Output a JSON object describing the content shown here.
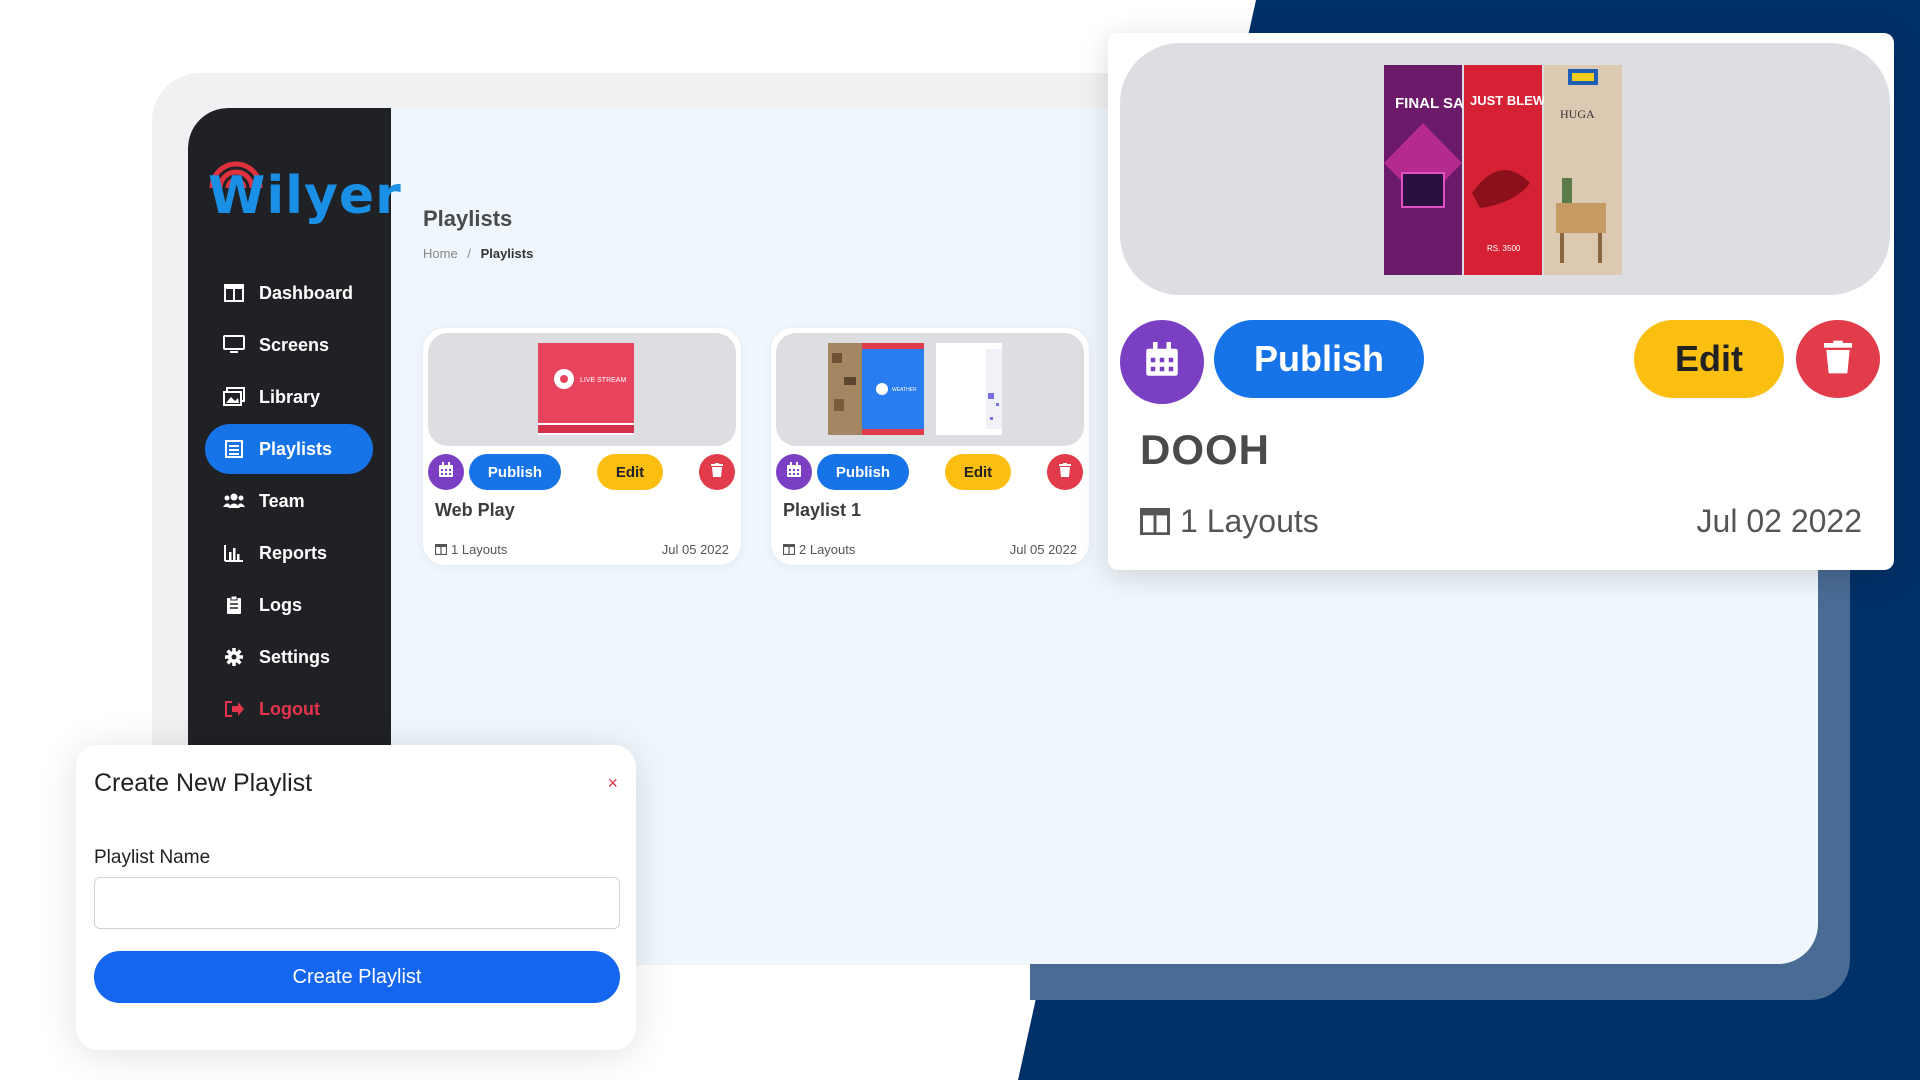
{
  "brand": {
    "name": "Wilyer",
    "color": "#1a8fe6"
  },
  "sidebar": {
    "items": [
      {
        "label": "Dashboard",
        "icon": "dashboard-icon"
      },
      {
        "label": "Screens",
        "icon": "monitor-icon"
      },
      {
        "label": "Library",
        "icon": "images-icon"
      },
      {
        "label": "Playlists",
        "icon": "list-icon",
        "active": true
      },
      {
        "label": "Team",
        "icon": "users-icon"
      },
      {
        "label": "Reports",
        "icon": "bar-chart-icon"
      },
      {
        "label": "Logs",
        "icon": "clipboard-icon"
      },
      {
        "label": "Settings",
        "icon": "gear-icon"
      },
      {
        "label": "Logout",
        "icon": "sign-out-icon"
      }
    ]
  },
  "page": {
    "title": "Playlists",
    "breadcrumb": {
      "home": "Home",
      "separator": "/",
      "current": "Playlists"
    }
  },
  "cards": [
    {
      "name": "Web Play",
      "layouts": "1 Layouts",
      "date": "Jul 05 2022",
      "publish_label": "Publish",
      "edit_label": "Edit",
      "thumb_label": "LIVE STREAM"
    },
    {
      "name": "Playlist 1",
      "layouts": "2 Layouts",
      "date": "Jul 05 2022",
      "publish_label": "Publish",
      "edit_label": "Edit",
      "thumb_label": "WEATHER"
    }
  ],
  "zoom_card": {
    "name": "DOOH",
    "layouts": "1 Layouts",
    "date": "Jul 02 2022",
    "publish_label": "Publish",
    "edit_label": "Edit",
    "ads": [
      "FINAL SALE",
      "JUST BLEW IT",
      "HUGA"
    ],
    "ad_price": "RS. 3500"
  },
  "modal": {
    "title": "Create New Playlist",
    "close": "×",
    "field_label": "Playlist Name",
    "field_value": "",
    "submit_label": "Create Playlist"
  },
  "colors": {
    "navy": "#003068",
    "primary": "#1773e8",
    "purple": "#7b3fc4",
    "yellow": "#fbbf12",
    "red": "#e23b4a",
    "sidebar": "#1f2125"
  }
}
